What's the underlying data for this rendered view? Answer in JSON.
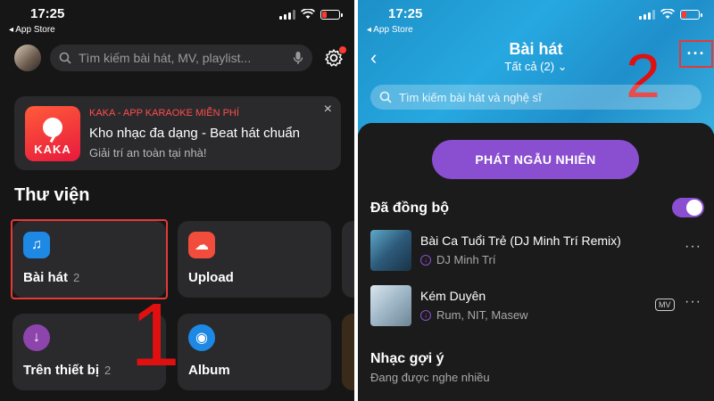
{
  "status_bar": {
    "time": "17:25",
    "back_app": "◂ App Store"
  },
  "left": {
    "search_placeholder": "Tìm kiếm bài hát, MV, playlist...",
    "banner": {
      "logo_text": "KAKA",
      "tag": "KAKA - APP KARAOKE MIỄN PHÍ",
      "title": "Kho nhạc đa dạng - Beat hát chuẩn",
      "subtitle": "Giải trí an toàn tại nhà!",
      "close": "×"
    },
    "section_title": "Thư viện",
    "library": [
      {
        "label": "Bài hát",
        "count": "2",
        "icon": "music-note-icon",
        "color": "#1e88e5"
      },
      {
        "label": "Upload",
        "count": "",
        "icon": "cloud-upload-icon",
        "color": "#f24c3d"
      },
      {
        "label": "Trên thiết bị",
        "count": "2",
        "icon": "download-icon",
        "color": "#8e44ad"
      },
      {
        "label": "Album",
        "count": "",
        "icon": "album-icon",
        "color": "#1e88e5"
      }
    ],
    "step_number": "1"
  },
  "right": {
    "title": "Bài hát",
    "filter": "Tất cả (2) ⌄",
    "more": "···",
    "search_placeholder": "Tìm kiếm bài hát và nghệ sĩ",
    "shuffle_label": "PHÁT NGẪU NHIÊN",
    "synced_label": "Đã đồng bộ",
    "songs": [
      {
        "title": "Bài Ca Tuổi Trẻ (DJ Minh Trí Remix)",
        "artist": "DJ Minh Trí",
        "mv": ""
      },
      {
        "title": "Kém Duyên",
        "artist": "Rum, NIT, Masew",
        "mv": "MV"
      }
    ],
    "suggest_title": "Nhạc gợi ý",
    "suggest_sub": "Đang được nghe nhiều",
    "step_number": "2"
  },
  "colors": {
    "accent_purple": "#8a4fd0",
    "highlight_red": "#e53935",
    "header_blue": "#27a8e0"
  }
}
